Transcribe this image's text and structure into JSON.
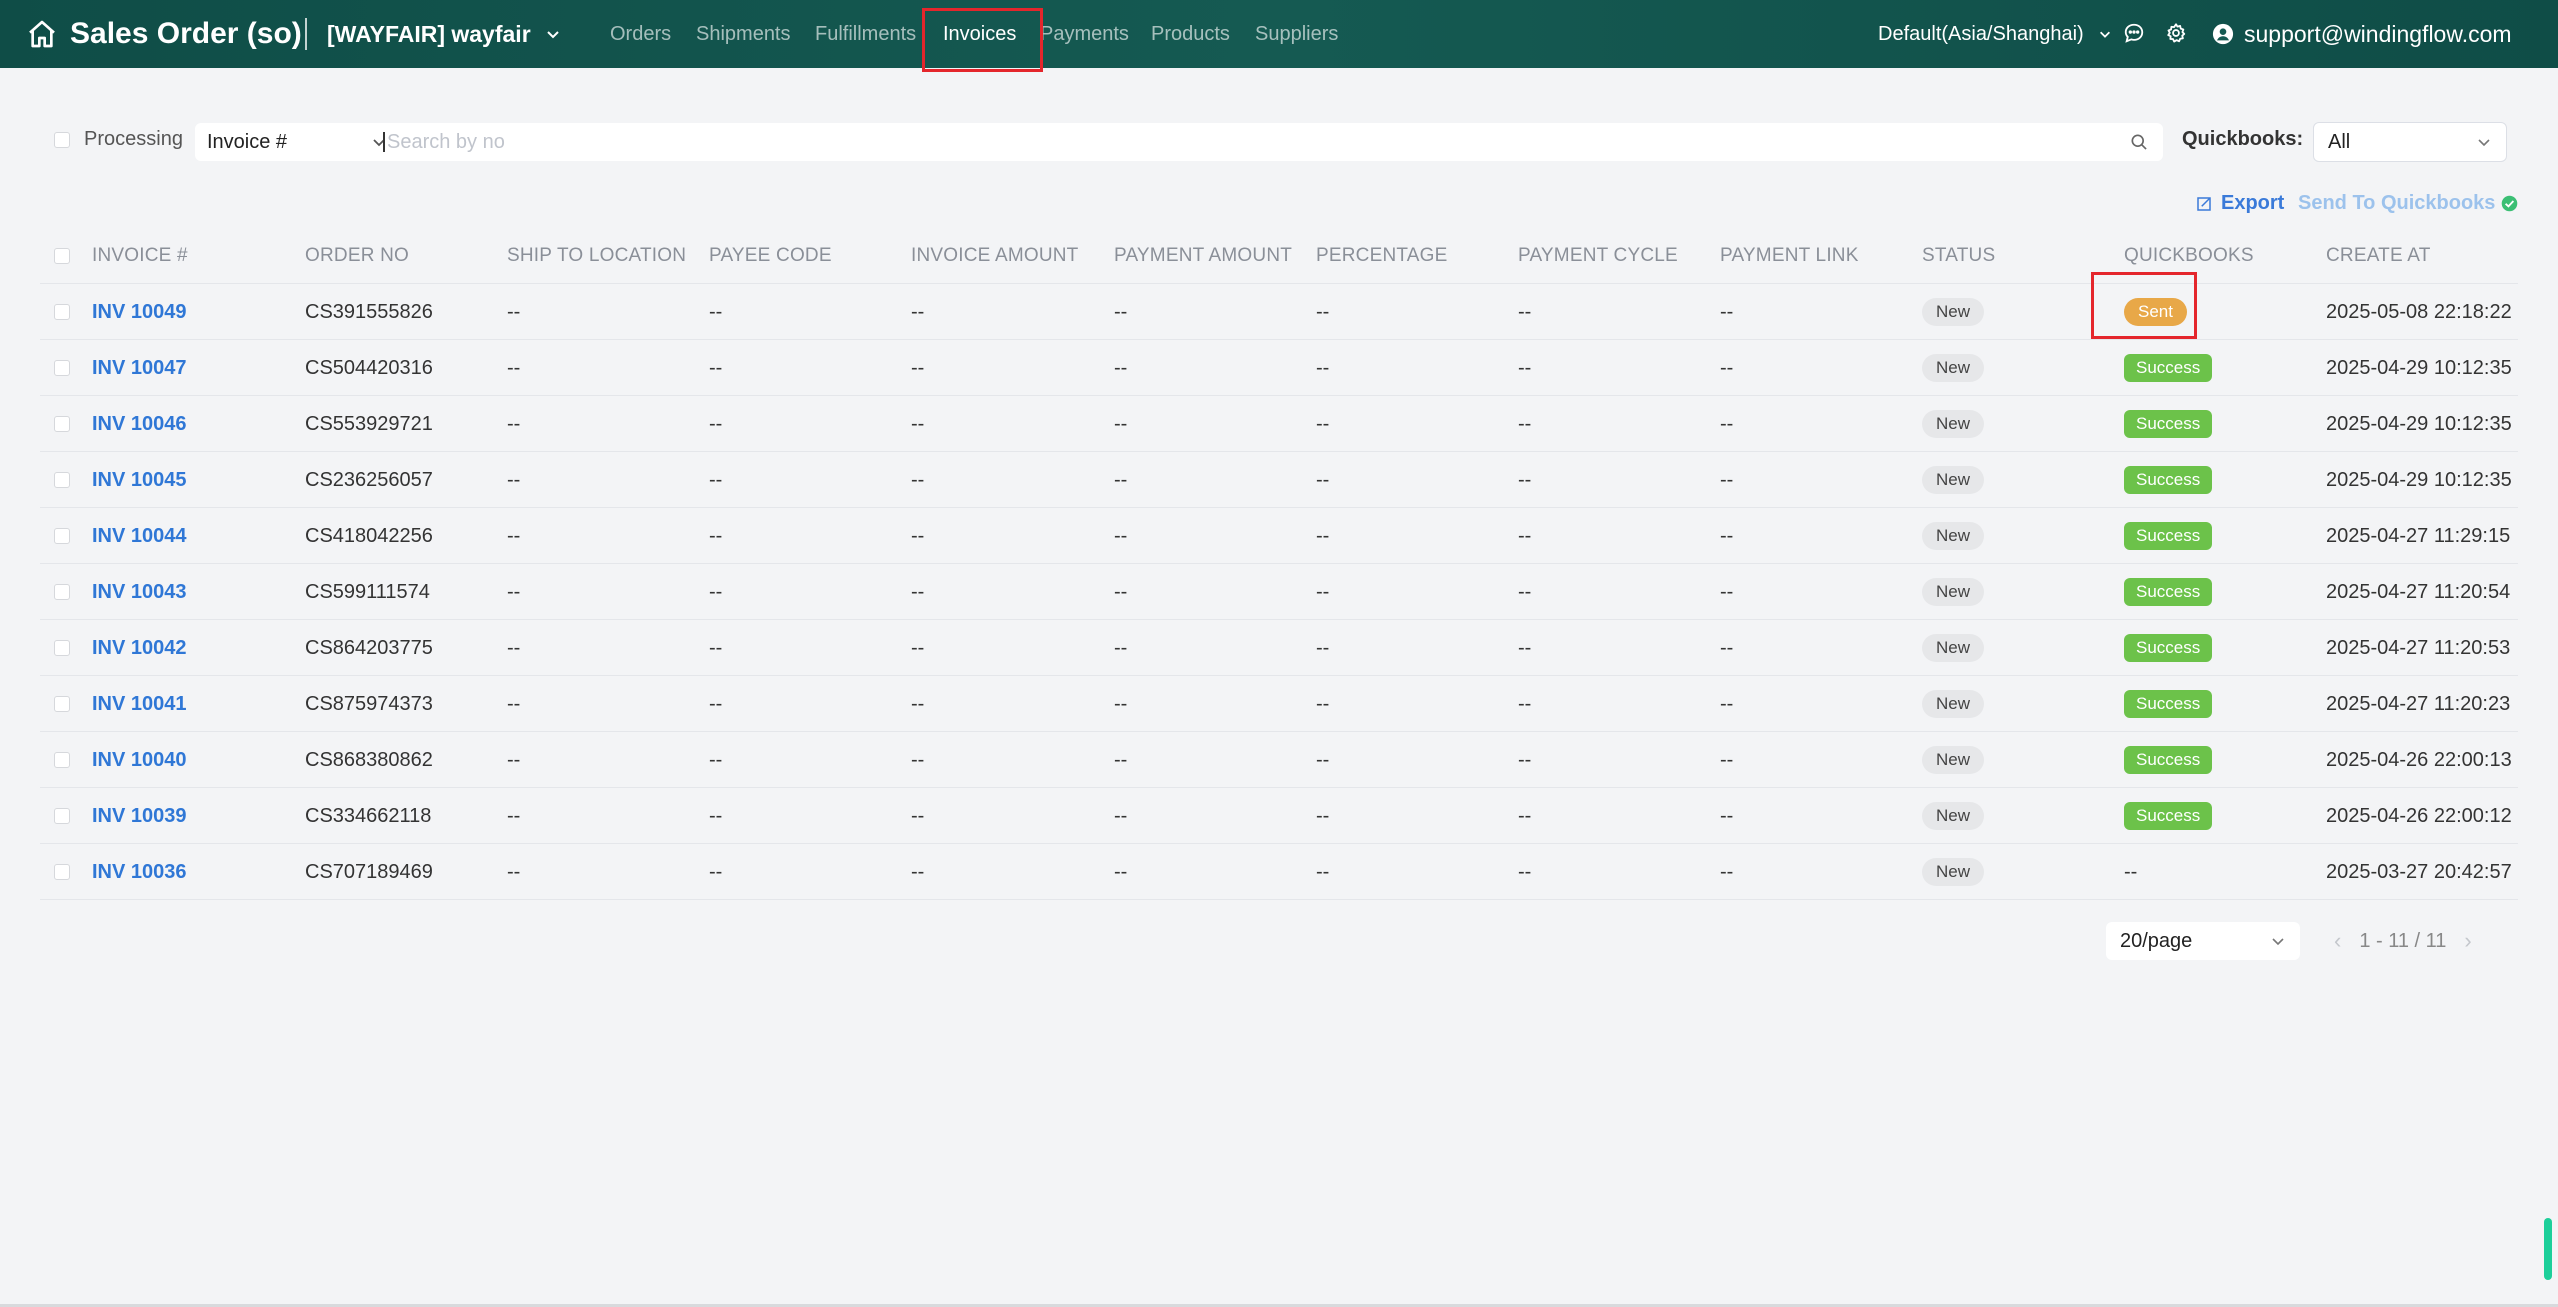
{
  "header": {
    "app_title": "Sales Order (so)",
    "store": "[WAYFAIR] wayfair",
    "nav": [
      "Orders",
      "Shipments",
      "Fulfillments",
      "Invoices",
      "Payments",
      "Products",
      "Suppliers"
    ],
    "active_nav": "Invoices",
    "timezone": "Default(Asia/Shanghai)",
    "user_email": "support@windingflow.com",
    "icons": [
      "home-icon",
      "chevron-down-icon",
      "chat-icon",
      "gear-icon",
      "user-icon"
    ]
  },
  "filters": {
    "processing_label": "Processing",
    "search_field": "Invoice #",
    "search_placeholder": "Search by no",
    "quickbooks_label": "Quickbooks:",
    "quickbooks_value": "All"
  },
  "actions": {
    "export_label": "Export",
    "send_qb_label": "Send To Quickbooks"
  },
  "table": {
    "columns": [
      "INVOICE #",
      "ORDER NO",
      "SHIP TO LOCATION",
      "PAYEE CODE",
      "INVOICE AMOUNT",
      "PAYMENT AMOUNT",
      "PERCENTAGE",
      "PAYMENT CYCLE",
      "PAYMENT LINK",
      "STATUS",
      "QUICKBOOKS",
      "CREATE AT"
    ],
    "rows": [
      {
        "invoice": "INV 10049",
        "order": "CS391555826",
        "ship": "--",
        "payee": "--",
        "inv_amount": "--",
        "pay_amount": "--",
        "pct": "--",
        "cycle": "--",
        "link": "--",
        "status": "New",
        "qb": "Sent",
        "created": "2025-05-08 22:18:22"
      },
      {
        "invoice": "INV 10047",
        "order": "CS504420316",
        "ship": "--",
        "payee": "--",
        "inv_amount": "--",
        "pay_amount": "--",
        "pct": "--",
        "cycle": "--",
        "link": "--",
        "status": "New",
        "qb": "Success",
        "created": "2025-04-29 10:12:35"
      },
      {
        "invoice": "INV 10046",
        "order": "CS553929721",
        "ship": "--",
        "payee": "--",
        "inv_amount": "--",
        "pay_amount": "--",
        "pct": "--",
        "cycle": "--",
        "link": "--",
        "status": "New",
        "qb": "Success",
        "created": "2025-04-29 10:12:35"
      },
      {
        "invoice": "INV 10045",
        "order": "CS236256057",
        "ship": "--",
        "payee": "--",
        "inv_amount": "--",
        "pay_amount": "--",
        "pct": "--",
        "cycle": "--",
        "link": "--",
        "status": "New",
        "qb": "Success",
        "created": "2025-04-29 10:12:35"
      },
      {
        "invoice": "INV 10044",
        "order": "CS418042256",
        "ship": "--",
        "payee": "--",
        "inv_amount": "--",
        "pay_amount": "--",
        "pct": "--",
        "cycle": "--",
        "link": "--",
        "status": "New",
        "qb": "Success",
        "created": "2025-04-27 11:29:15"
      },
      {
        "invoice": "INV 10043",
        "order": "CS599111574",
        "ship": "--",
        "payee": "--",
        "inv_amount": "--",
        "pay_amount": "--",
        "pct": "--",
        "cycle": "--",
        "link": "--",
        "status": "New",
        "qb": "Success",
        "created": "2025-04-27 11:20:54"
      },
      {
        "invoice": "INV 10042",
        "order": "CS864203775",
        "ship": "--",
        "payee": "--",
        "inv_amount": "--",
        "pay_amount": "--",
        "pct": "--",
        "cycle": "--",
        "link": "--",
        "status": "New",
        "qb": "Success",
        "created": "2025-04-27 11:20:53"
      },
      {
        "invoice": "INV 10041",
        "order": "CS875974373",
        "ship": "--",
        "payee": "--",
        "inv_amount": "--",
        "pay_amount": "--",
        "pct": "--",
        "cycle": "--",
        "link": "--",
        "status": "New",
        "qb": "Success",
        "created": "2025-04-27 11:20:23"
      },
      {
        "invoice": "INV 10040",
        "order": "CS868380862",
        "ship": "--",
        "payee": "--",
        "inv_amount": "--",
        "pay_amount": "--",
        "pct": "--",
        "cycle": "--",
        "link": "--",
        "status": "New",
        "qb": "Success",
        "created": "2025-04-26 22:00:13"
      },
      {
        "invoice": "INV 10039",
        "order": "CS334662118",
        "ship": "--",
        "payee": "--",
        "inv_amount": "--",
        "pay_amount": "--",
        "pct": "--",
        "cycle": "--",
        "link": "--",
        "status": "New",
        "qb": "Success",
        "created": "2025-04-26 22:00:12"
      },
      {
        "invoice": "INV 10036",
        "order": "CS707189469",
        "ship": "--",
        "payee": "--",
        "inv_amount": "--",
        "pay_amount": "--",
        "pct": "--",
        "cycle": "--",
        "link": "--",
        "status": "New",
        "qb": "--",
        "created": "2025-03-27 20:42:57"
      }
    ]
  },
  "pagination": {
    "page_size": "20/page",
    "range": "1 - 11 / 11"
  },
  "colors": {
    "header_bg": "#155a52",
    "link": "#2f77d6",
    "success": "#6cc24a",
    "sent": "#e8a848",
    "highlight": "#e4262c"
  }
}
